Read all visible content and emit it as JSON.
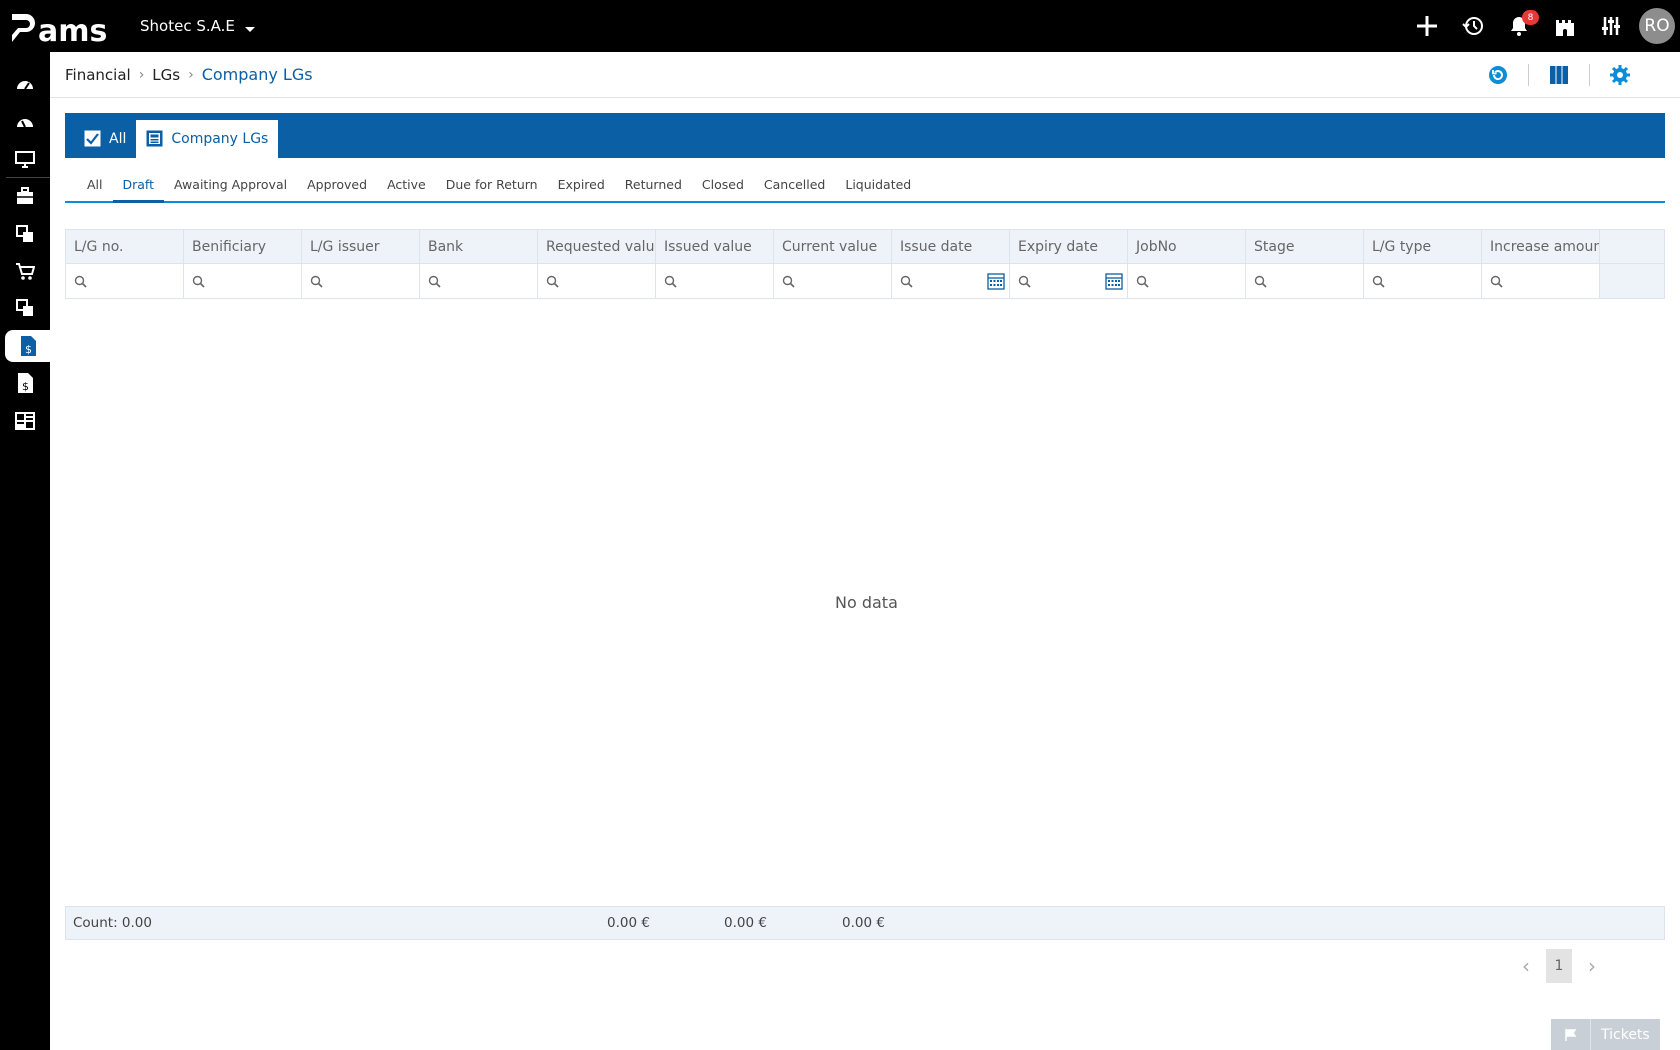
{
  "app": {
    "logo_text": "Pams",
    "company": "Shotec S.A.E",
    "notifications_count": "8",
    "user_initials": "RO"
  },
  "breadcrumb": {
    "items": [
      "Financial",
      "LGs"
    ],
    "current": "Company LGs"
  },
  "view_tabs": [
    {
      "label": "All",
      "icon": "checkbox-icon",
      "selected": false
    },
    {
      "label": "Company LGs",
      "icon": "company-lg-icon",
      "selected": true
    }
  ],
  "status_tabs": [
    "All",
    "Draft",
    "Awaiting Approval",
    "Approved",
    "Active",
    "Due for Return",
    "Expired",
    "Returned",
    "Closed",
    "Cancelled",
    "Liquidated"
  ],
  "active_status_tab": "Draft",
  "grid": {
    "columns": [
      "L/G no.",
      "Benificiary",
      "L/G issuer",
      "Bank",
      "Requested value",
      "Issued value",
      "Current value",
      "Issue date",
      "Expiry date",
      "JobNo",
      "Stage",
      "L/G type",
      "Increase amount"
    ],
    "empty_text": "No data"
  },
  "summary": {
    "count": "Count: 0.00",
    "requested_total": "0.00 €",
    "issued_total": "0.00 €",
    "current_total": "0.00 €"
  },
  "pagination": {
    "current_page": "1"
  },
  "tickets": {
    "label": "Tickets"
  },
  "colors": {
    "primary": "#0b5fa5",
    "accent": "#0b8dd9",
    "header_bg": "#000000",
    "grid_head_bg": "#eef3fa",
    "badge": "#e53935"
  }
}
